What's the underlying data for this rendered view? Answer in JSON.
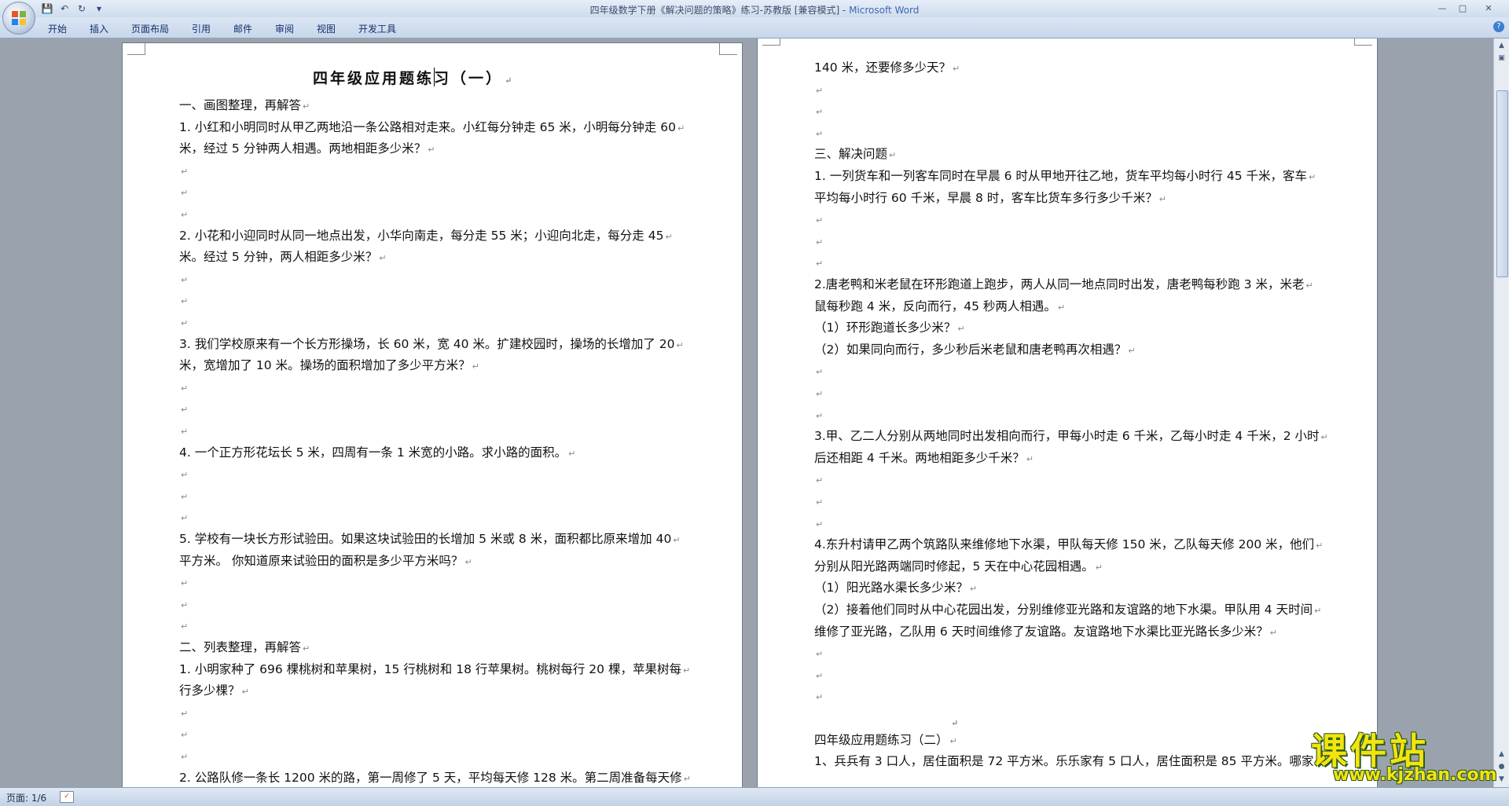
{
  "window": {
    "doc_title": "四年级数学下册《解决问题的策略》练习-苏教版 [兼容模式] - ",
    "app_name": "Microsoft Word"
  },
  "quick_access": {
    "save": "💾",
    "undo": "↶",
    "redo": "↻",
    "more": "▾"
  },
  "window_controls": {
    "minimize": "—",
    "restore": "□",
    "close": "✕"
  },
  "ribbon": {
    "tabs": [
      "开始",
      "插入",
      "页面布局",
      "引用",
      "邮件",
      "审阅",
      "视图",
      "开发工具"
    ],
    "help": "?"
  },
  "page1": {
    "title": "四年级应用题练习（一）",
    "lines": [
      "一、画图整理，再解答",
      "1.  小红和小明同时从甲乙两地沿一条公路相对走来。小红每分钟走 65 米，小明每分钟走 60",
      "米，经过 5 分钟两人相遇。两地相距多少米？",
      "",
      "",
      "",
      "2.  小花和小迎同时从同一地点出发，小华向南走，每分走  55  米；小迎向北走，每分走  45",
      "米。经过 5 分钟，两人相距多少米？",
      "",
      "",
      "",
      "3.  我们学校原来有一个长方形操场，长 60 米，宽 40 米。扩建校园时，操场的长增加了 20",
      "米，宽增加了 10 米。操场的面积增加了多少平方米？",
      "",
      "",
      "",
      "4.  一个正方形花坛长 5 米，四周有一条 1 米宽的小路。求小路的面积。",
      "",
      "",
      "",
      "5.  学校有一块长方形试验田。如果这块试验田的长增加 5 米或 8 米，面积都比原来增加 40",
      "平方米。        你知道原来试验田的面积是多少平方米吗？",
      "",
      "",
      "",
      "二、列表整理，再解答",
      "1.  小明家种了 696 棵桃树和苹果树，15 行桃树和 18 行苹果树。桃树每行 20 棵，苹果树每",
      "行多少棵？",
      "",
      "",
      "",
      "2.  公路队修一条长 1200 米的路，第一周修了 5 天，平均每天修 128 米。第二周准备每天修"
    ]
  },
  "page2": {
    "lines": [
      "140 米，还要修多少天？",
      "",
      "",
      "",
      "三、解决问题",
      "1.  一列货车和一列客车同时在早晨 6 时从甲地开往乙地，货车平均每小时行 45 千米，客车",
      "平均每小时行 60 千米，早晨 8 时，客车比货车多行多少千米？",
      "",
      "",
      "",
      "2.唐老鸭和米老鼠在环形跑道上跑步，两人从同一地点同时出发，唐老鸭每秒跑  3  米，米老",
      "鼠每秒跑 4 米，反向而行，45 秒两人相遇。",
      "（1）环形跑道长多少米？",
      "（2）如果同向而行，多少秒后米老鼠和唐老鸭再次相遇？",
      "",
      "",
      "",
      "3.甲、乙二人分别从两地同时出发相向而行，甲每小时走 6 千米，乙每小时走 4 千米，2 小时",
      "后还相距 4 千米。两地相距多少千米？",
      "",
      "",
      "",
      "4.东升村请甲乙两个筑路队来维修地下水渠，甲队每天修 150 米，乙队每天修 200 米，他们",
      "分别从阳光路两端同时修起，5 天在中心花园相遇。",
      "（1）阳光路水渠长多少米？",
      "（2）接着他们同时从中心花园出发，分别维修亚光路和友谊路的地下水渠。甲队用 4 天时间",
      "维修了亚光路，乙队用 6 天时间维修了友谊路。友谊路地下水渠比亚光路长多少米？",
      "",
      "",
      "",
      "",
      "四年级应用题练习（二）",
      "1、兵兵有 3 口人，居住面积是 72 平方米。乐乐家有 5 口人，居住面积是 85 平方米。哪家"
    ]
  },
  "paragraph_mark": "↵",
  "status": {
    "page_info": "页面: 1/6"
  },
  "watermark": {
    "brand": "课件站",
    "url": "www.kjzhan.com"
  }
}
